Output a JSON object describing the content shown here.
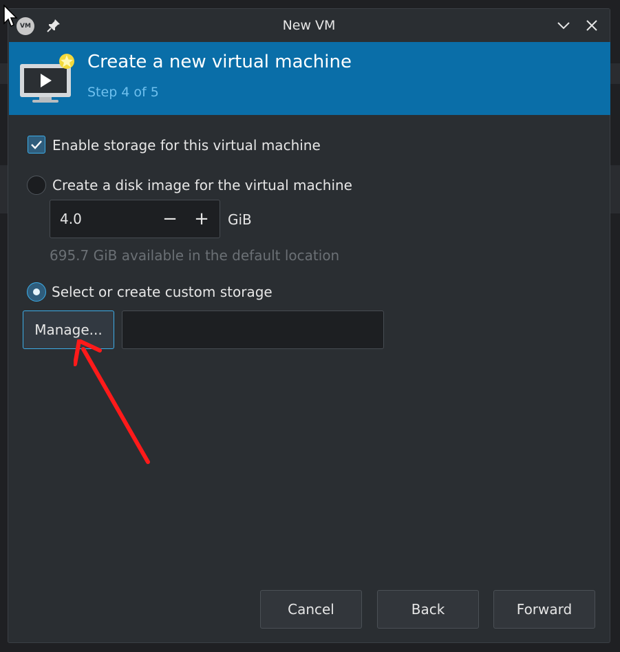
{
  "window": {
    "title": "New VM",
    "app_icon_text": "VM"
  },
  "header": {
    "title": "Create a new virtual machine",
    "step": "Step 4 of 5"
  },
  "storage": {
    "enable_label": "Enable storage for this virtual machine",
    "enable_checked": true,
    "create_disk_label": "Create a disk image for the virtual machine",
    "create_disk_selected": false,
    "disk_size_value": "4.0",
    "disk_size_unit": "GiB",
    "available_text": "695.7 GiB available in the default location",
    "custom_label": "Select or create custom storage",
    "custom_selected": true,
    "manage_label": "Manage...",
    "custom_path_value": ""
  },
  "footer": {
    "cancel_label": "Cancel",
    "back_label": "Back",
    "forward_label": "Forward"
  },
  "colors": {
    "header_bg": "#0a6ea8",
    "accent": "#3daee9",
    "annotation_arrow": "#ff1a1a"
  }
}
